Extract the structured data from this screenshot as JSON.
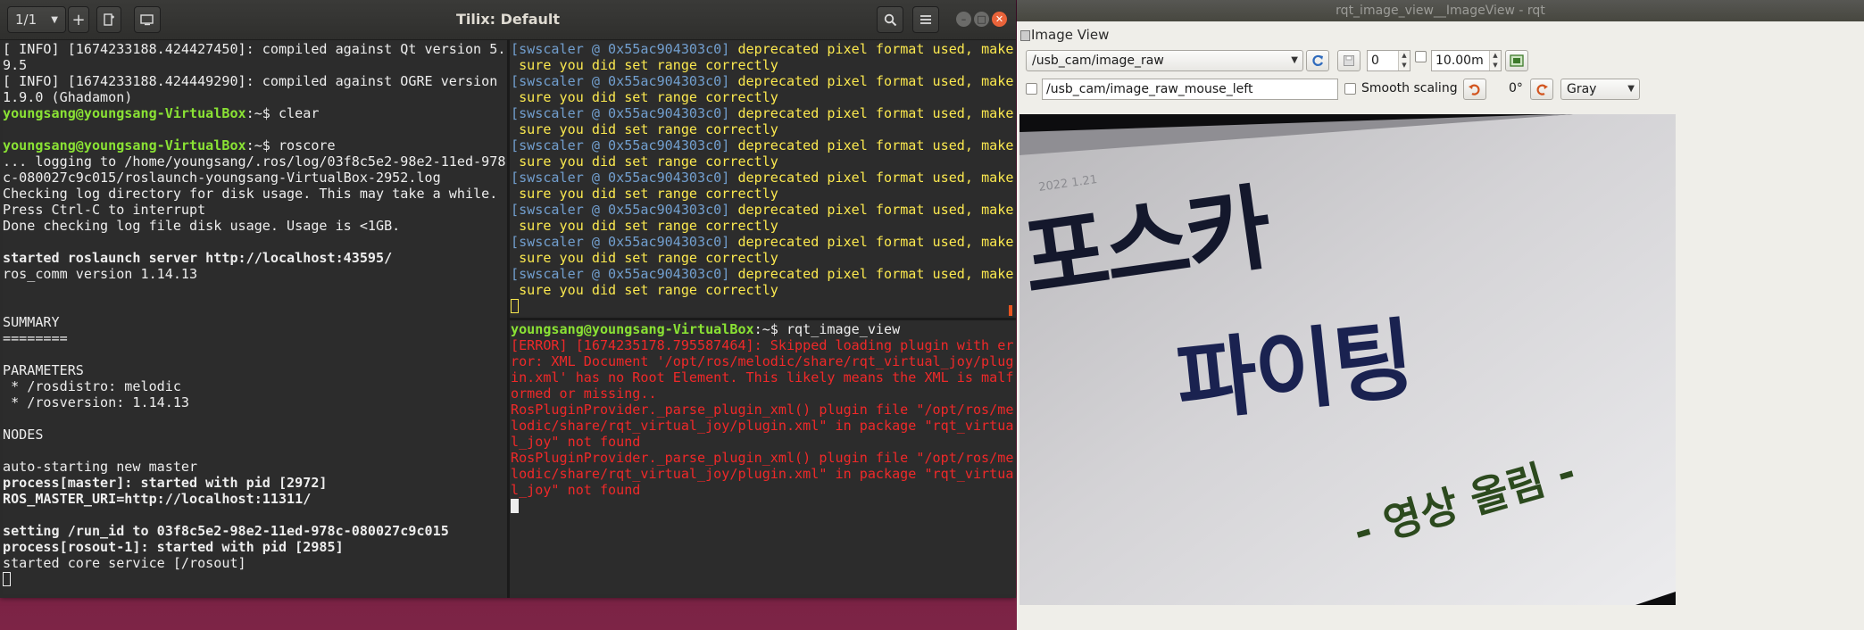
{
  "tilix": {
    "session_indicator": "1/1",
    "title": "Tilix: Default",
    "left_pane": [
      [
        {
          "t": "[ INFO] [1674233188.424427450]: compiled against Qt version 5.",
          "c": ""
        }
      ],
      [
        {
          "t": "9.5",
          "c": ""
        }
      ],
      [
        {
          "t": "[ INFO] [1674233188.424449290]: compiled against OGRE version",
          "c": ""
        }
      ],
      [
        {
          "t": "1.9.0 (Ghadamon)",
          "c": ""
        }
      ],
      [
        {
          "t": "youngsang@youngsang-VirtualBox",
          "c": "g"
        },
        {
          "t": ":~$ clear",
          "c": ""
        }
      ],
      [
        {
          "t": "",
          "c": ""
        }
      ],
      [
        {
          "t": "youngsang@youngsang-VirtualBox",
          "c": "g"
        },
        {
          "t": ":~$ roscore",
          "c": ""
        }
      ],
      [
        {
          "t": "... logging to /home/youngsang/.ros/log/03f8c5e2-98e2-11ed-978",
          "c": ""
        }
      ],
      [
        {
          "t": "c-080027c9c015/roslaunch-youngsang-VirtualBox-2952.log",
          "c": ""
        }
      ],
      [
        {
          "t": "Checking log directory for disk usage. This may take a while.",
          "c": ""
        }
      ],
      [
        {
          "t": "Press Ctrl-C to interrupt",
          "c": ""
        }
      ],
      [
        {
          "t": "Done checking log file disk usage. Usage is <1GB.",
          "c": ""
        }
      ],
      [
        {
          "t": "",
          "c": ""
        }
      ],
      [
        {
          "t": "started roslaunch server http://localhost:43595/",
          "c": "b"
        }
      ],
      [
        {
          "t": "ros_comm version 1.14.13",
          "c": ""
        }
      ],
      [
        {
          "t": "",
          "c": ""
        }
      ],
      [
        {
          "t": "",
          "c": ""
        }
      ],
      [
        {
          "t": "SUMMARY",
          "c": ""
        }
      ],
      [
        {
          "t": "========",
          "c": ""
        }
      ],
      [
        {
          "t": "",
          "c": ""
        }
      ],
      [
        {
          "t": "PARAMETERS",
          "c": ""
        }
      ],
      [
        {
          "t": " * /rosdistro: melodic",
          "c": ""
        }
      ],
      [
        {
          "t": " * /rosversion: 1.14.13",
          "c": ""
        }
      ],
      [
        {
          "t": "",
          "c": ""
        }
      ],
      [
        {
          "t": "NODES",
          "c": ""
        }
      ],
      [
        {
          "t": "",
          "c": ""
        }
      ],
      [
        {
          "t": "auto-starting new master",
          "c": ""
        }
      ],
      [
        {
          "t": "process[master]: started with pid [2972]",
          "c": "b"
        }
      ],
      [
        {
          "t": "ROS_MASTER_URI=http://localhost:11311/",
          "c": "b"
        }
      ],
      [
        {
          "t": "",
          "c": ""
        }
      ],
      [
        {
          "t": "setting /run_id to 03f8c5e2-98e2-11ed-978c-080027c9c015",
          "c": "b"
        }
      ],
      [
        {
          "t": "process[rosout-1]: started with pid [2985]",
          "c": "b"
        }
      ],
      [
        {
          "t": "started core service [/rosout]",
          "c": ""
        }
      ]
    ],
    "right_top_pane": [
      [
        {
          "t": "[swscaler @ 0x55ac904303c0] ",
          "c": "blue"
        },
        {
          "t": "deprecated pixel format used, make",
          "c": "yel"
        }
      ],
      [
        {
          "t": " sure you did set range correctly",
          "c": "yel"
        }
      ],
      [
        {
          "t": "[swscaler @ 0x55ac904303c0] ",
          "c": "blue"
        },
        {
          "t": "deprecated pixel format used, make",
          "c": "yel"
        }
      ],
      [
        {
          "t": " sure you did set range correctly",
          "c": "yel"
        }
      ],
      [
        {
          "t": "[swscaler @ 0x55ac904303c0] ",
          "c": "blue"
        },
        {
          "t": "deprecated pixel format used, make",
          "c": "yel"
        }
      ],
      [
        {
          "t": " sure you did set range correctly",
          "c": "yel"
        }
      ],
      [
        {
          "t": "[swscaler @ 0x55ac904303c0] ",
          "c": "blue"
        },
        {
          "t": "deprecated pixel format used, make",
          "c": "yel"
        }
      ],
      [
        {
          "t": " sure you did set range correctly",
          "c": "yel"
        }
      ],
      [
        {
          "t": "[swscaler @ 0x55ac904303c0] ",
          "c": "blue"
        },
        {
          "t": "deprecated pixel format used, make",
          "c": "yel"
        }
      ],
      [
        {
          "t": " sure you did set range correctly",
          "c": "yel"
        }
      ],
      [
        {
          "t": "[swscaler @ 0x55ac904303c0] ",
          "c": "blue"
        },
        {
          "t": "deprecated pixel format used, make",
          "c": "yel"
        }
      ],
      [
        {
          "t": " sure you did set range correctly",
          "c": "yel"
        }
      ],
      [
        {
          "t": "[swscaler @ 0x55ac904303c0] ",
          "c": "blue"
        },
        {
          "t": "deprecated pixel format used, make",
          "c": "yel"
        }
      ],
      [
        {
          "t": " sure you did set range correctly",
          "c": "yel"
        }
      ],
      [
        {
          "t": "[swscaler @ 0x55ac904303c0] ",
          "c": "blue"
        },
        {
          "t": "deprecated pixel format used, make",
          "c": "yel"
        }
      ],
      [
        {
          "t": " sure you did set range correctly",
          "c": "yel"
        }
      ]
    ],
    "right_bottom_pane": [
      [
        {
          "t": "youngsang@youngsang-VirtualBox",
          "c": "g"
        },
        {
          "t": ":~$ rqt_image_view",
          "c": ""
        }
      ],
      [
        {
          "t": "[ERROR] [1674235178.795587464]: Skipped loading plugin with er",
          "c": "red"
        }
      ],
      [
        {
          "t": "ror: XML Document '/opt/ros/melodic/share/rqt_virtual_joy/plug",
          "c": "red"
        }
      ],
      [
        {
          "t": "in.xml' has no Root Element. This likely means the XML is malf",
          "c": "red"
        }
      ],
      [
        {
          "t": "ormed or missing..",
          "c": "red"
        }
      ],
      [
        {
          "t": "RosPluginProvider._parse_plugin_xml() plugin file \"/opt/ros/me",
          "c": "red"
        }
      ],
      [
        {
          "t": "lodic/share/rqt_virtual_joy/plugin.xml\" in package \"rqt_virtua",
          "c": "red"
        }
      ],
      [
        {
          "t": "l_joy\" not found",
          "c": "red"
        }
      ],
      [
        {
          "t": "RosPluginProvider._parse_plugin_xml() plugin file \"/opt/ros/me",
          "c": "red"
        }
      ],
      [
        {
          "t": "lodic/share/rqt_virtual_joy/plugin.xml\" in package \"rqt_virtua",
          "c": "red"
        }
      ],
      [
        {
          "t": "l_joy\" not found",
          "c": "red"
        }
      ]
    ]
  },
  "rqt": {
    "window_title": "rqt_image_view__ImageView - rqt",
    "plugin_label": "Image View",
    "topic_combo": "/usb_cam/image_raw",
    "spin_value": "0",
    "time_value": "10.00m",
    "mouse_topic": "/usb_cam/image_raw_mouse_left",
    "smooth_scaling_label": "Smooth scaling",
    "rotation_label": "0°",
    "color_combo": "Gray",
    "image_text": {
      "line1": "포스카",
      "line2": "파이팅",
      "line3": "- 영상 올림 -",
      "date_stamp": "2022 1.21"
    }
  },
  "colors": {
    "terminal_bg": "#2c2c2c",
    "prompt_green": "#8ae234",
    "warn_yellow": "#fce94f",
    "swscaler_blue": "#729fcf",
    "error_red": "#ef2929",
    "desktop_aubergine": "#5e1535"
  },
  "icons": [
    "chevron-down-icon",
    "plus-icon",
    "split-add-icon",
    "window-add-icon",
    "search-icon",
    "hamburger-icon",
    "minimize-icon",
    "maximize-icon",
    "close-icon",
    "refresh-icon",
    "save-icon",
    "rotate-left-icon",
    "rotate-right-icon",
    "grid-icon"
  ]
}
